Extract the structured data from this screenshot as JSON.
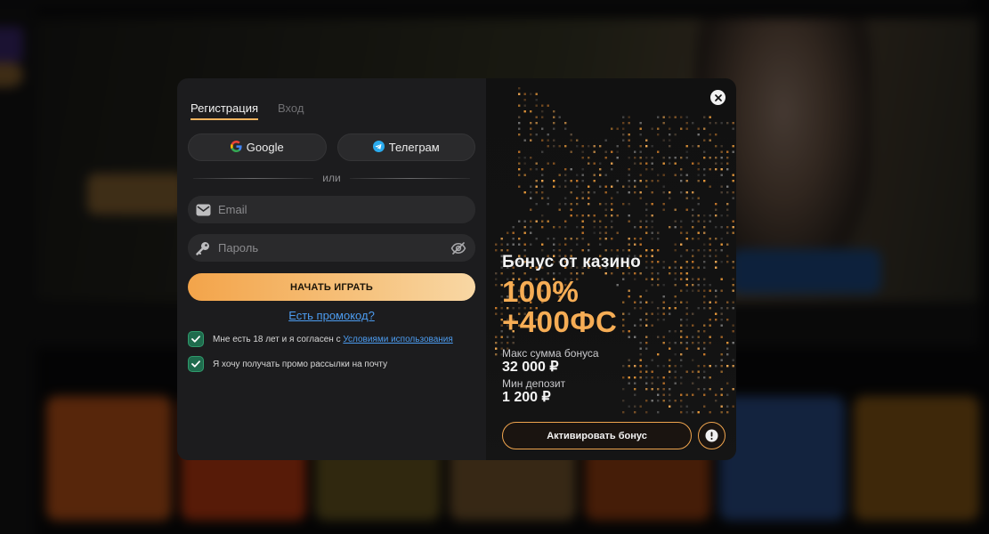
{
  "tabs": [
    {
      "label": "Регистрация",
      "active": true
    },
    {
      "label": "Вход",
      "active": false
    }
  ],
  "social": {
    "google": {
      "label": "Google",
      "icon": "google-icon"
    },
    "telegram": {
      "label": "Телеграм",
      "icon": "telegram-icon"
    }
  },
  "divider_text": "или",
  "form": {
    "email_placeholder": "Email",
    "password_placeholder": "Пароль",
    "submit_label": "НАЧАТЬ ИГРАТЬ",
    "promo_link": "Есть промокод?"
  },
  "checks": [
    {
      "text": "Мне есть 18 лет и я согласен с ",
      "link": "Условиями использования",
      "checked": true
    },
    {
      "text": "Я хочу получать промо рассылки на почту",
      "checked": true
    }
  ],
  "bonus": {
    "title": "Бонус от казино",
    "line1": "100%",
    "line2": "+400ФС",
    "max_label": "Макс сумма бонуса",
    "max_value": "32 000 ₽",
    "min_label": "Мин депозит",
    "min_value": "1 200 ₽",
    "activate_label": "Активировать бонус"
  },
  "colors": {
    "accent": "#f6ad55",
    "link": "#4c9cf0",
    "check": "#2f9a6c"
  }
}
